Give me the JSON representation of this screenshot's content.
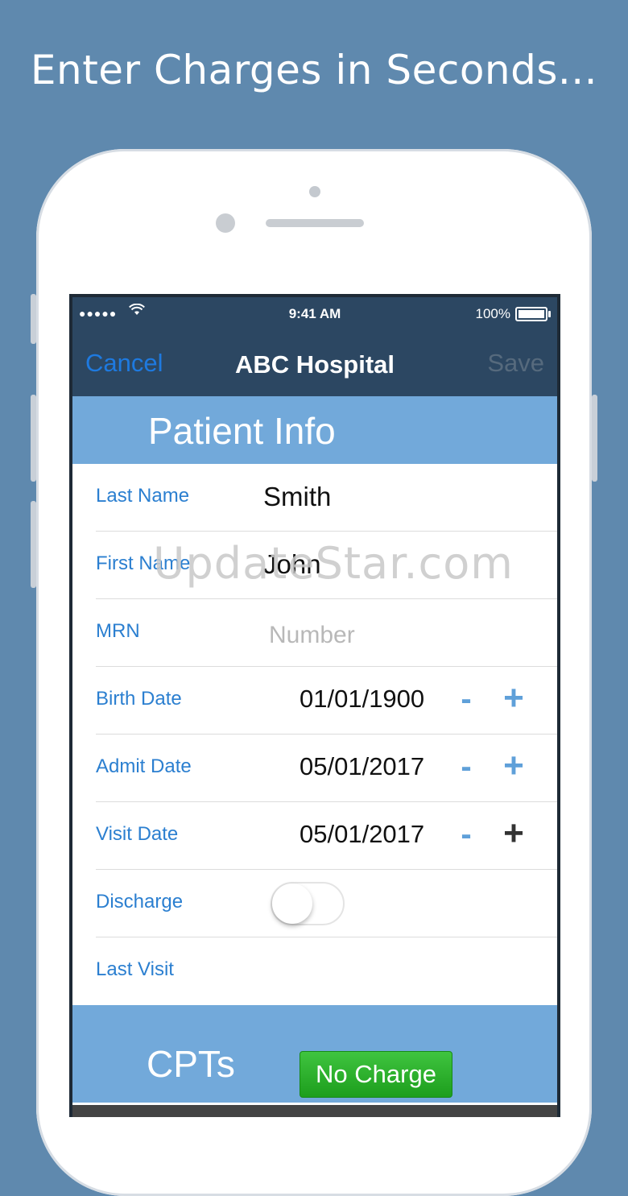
{
  "headline": "Enter Charges in Seconds...",
  "status_bar": {
    "signal": "●●●●●",
    "time": "9:41 AM",
    "battery": "100%"
  },
  "nav": {
    "cancel": "Cancel",
    "title": "ABC Hospital",
    "save": "Save"
  },
  "patient_section": {
    "title": "Patient Info"
  },
  "fields": {
    "last_name": {
      "label": "Last Name",
      "value": "Smith"
    },
    "first_name": {
      "label": "First Name",
      "value": "John"
    },
    "mrn": {
      "label": "MRN",
      "placeholder": "Number"
    },
    "birth_date": {
      "label": "Birth Date",
      "value": "01/01/1900"
    },
    "admit_date": {
      "label": "Admit Date",
      "value": "05/01/2017"
    },
    "visit_date": {
      "label": "Visit Date",
      "value": "05/01/2017"
    },
    "discharge": {
      "label": "Discharge",
      "on": false
    },
    "last_visit": {
      "label": "Last Visit"
    }
  },
  "stepper": {
    "minus": "-",
    "plus": "+"
  },
  "cpt_section": {
    "title": "CPTs",
    "no_charge": "No Charge"
  },
  "watermark": "UpdateStar.com",
  "colors": {
    "background": "#5f89ae",
    "navbar": "#2c4762",
    "section": "#72a9da",
    "link": "#1e7ae0",
    "label": "#2b7fd0",
    "no_charge": "#2db52d"
  }
}
